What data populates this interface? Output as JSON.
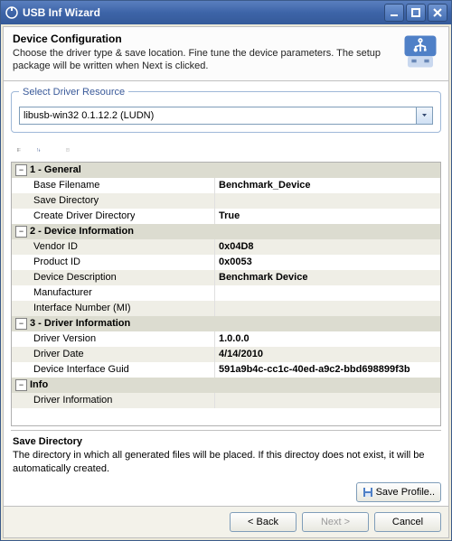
{
  "window": {
    "title": "USB Inf Wizard"
  },
  "header": {
    "title": "Device Configuration",
    "desc": "Choose the driver type & save location. Fine tune the device parameters.  The setup package will be written when Next is clicked."
  },
  "driver_resource": {
    "legend": "Select Driver Resource",
    "value": "libusb-win32 0.1.12.2 (LUDN)"
  },
  "sections": [
    {
      "title": "1 - General",
      "rows": [
        {
          "name": "Base Filename",
          "value": "Benchmark_Device"
        },
        {
          "name": "Save Directory",
          "value": ""
        },
        {
          "name": "Create Driver Directory",
          "value": "True"
        }
      ]
    },
    {
      "title": "2 - Device Information",
      "rows": [
        {
          "name": "Vendor ID",
          "value": "0x04D8"
        },
        {
          "name": "Product ID",
          "value": "0x0053"
        },
        {
          "name": "Device Description",
          "value": "Benchmark Device"
        },
        {
          "name": "Manufacturer",
          "value": ""
        },
        {
          "name": "Interface Number (MI)",
          "value": ""
        }
      ]
    },
    {
      "title": "3 - Driver Information",
      "rows": [
        {
          "name": "Driver Version",
          "value": "1.0.0.0"
        },
        {
          "name": "Driver Date",
          "value": "4/14/2010"
        },
        {
          "name": "Device Interface Guid",
          "value": "591a9b4c-cc1c-40ed-a9c2-bbd698899f3b"
        }
      ]
    },
    {
      "title": "Info",
      "rows": [
        {
          "name": "Driver Information",
          "value": ""
        }
      ]
    }
  ],
  "help": {
    "title": "Save Directory",
    "desc": "The directory in which all generated files will be placed.  If this directoy does not exist, it will be automatically created."
  },
  "buttons": {
    "save_profile": "Save Profile..",
    "back": "< Back",
    "next": "Next >",
    "cancel": "Cancel"
  }
}
